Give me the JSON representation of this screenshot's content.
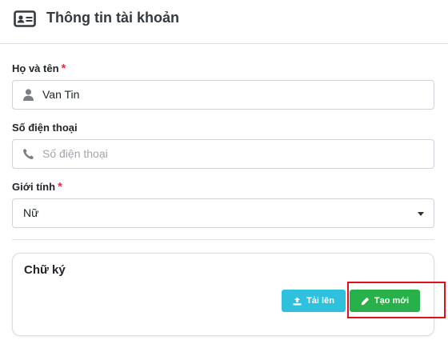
{
  "header": {
    "title": "Thông tin tài khoản",
    "icon": "id-card-icon"
  },
  "form": {
    "fullname": {
      "label": "Họ và tên",
      "required_mark": "*",
      "value": "Van Tin",
      "icon": "user-icon"
    },
    "phone": {
      "label": "Số điện thoại",
      "placeholder": "Số điện thoại",
      "value": "",
      "icon": "phone-icon"
    },
    "gender": {
      "label": "Giới tính",
      "required_mark": "*",
      "selected": "Nữ"
    }
  },
  "signature": {
    "title": "Chữ ký",
    "upload_label": "Tải lên",
    "create_label": "Tạo mới"
  },
  "colors": {
    "required": "#dc3545",
    "upload_button": "#2fc0de",
    "create_button": "#28b04a",
    "highlight_box": "#e0101a"
  }
}
